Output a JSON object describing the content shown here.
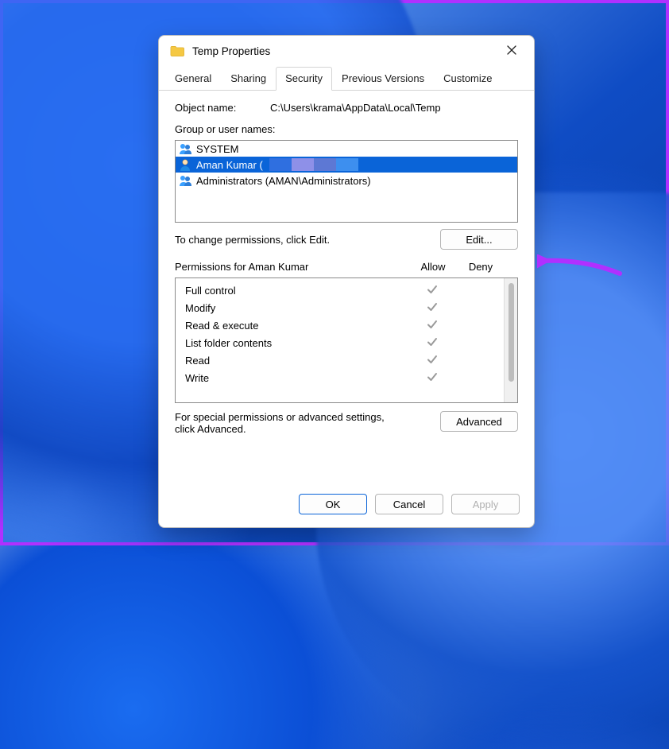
{
  "dialog": {
    "title": "Temp Properties",
    "tabs": [
      "General",
      "Sharing",
      "Security",
      "Previous Versions",
      "Customize"
    ],
    "active_tab": "Security",
    "object_name_label": "Object name:",
    "object_name": "C:\\Users\\krama\\AppData\\Local\\Temp",
    "group_label": "Group or user names:",
    "principals": [
      {
        "name": "SYSTEM",
        "icon": "group"
      },
      {
        "name": "Aman Kumar (",
        "icon": "user",
        "selected": true,
        "redacted": true
      },
      {
        "name": "Administrators (AMAN\\Administrators)",
        "icon": "group"
      }
    ],
    "change_hint": "To change permissions, click Edit.",
    "edit": "Edit...",
    "perm_for_label": "Permissions for Aman Kumar",
    "allow": "Allow",
    "deny": "Deny",
    "permissions": [
      {
        "name": "Full control",
        "allow": true,
        "deny": false
      },
      {
        "name": "Modify",
        "allow": true,
        "deny": false
      },
      {
        "name": "Read & execute",
        "allow": true,
        "deny": false
      },
      {
        "name": "List folder contents",
        "allow": true,
        "deny": false
      },
      {
        "name": "Read",
        "allow": true,
        "deny": false
      },
      {
        "name": "Write",
        "allow": true,
        "deny": false
      }
    ],
    "advanced_hint": "For special permissions or advanced settings, click Advanced.",
    "advanced": "Advanced",
    "ok": "OK",
    "cancel": "Cancel",
    "apply": "Apply"
  },
  "annotation": {
    "arrow_color": "#b030ff"
  }
}
